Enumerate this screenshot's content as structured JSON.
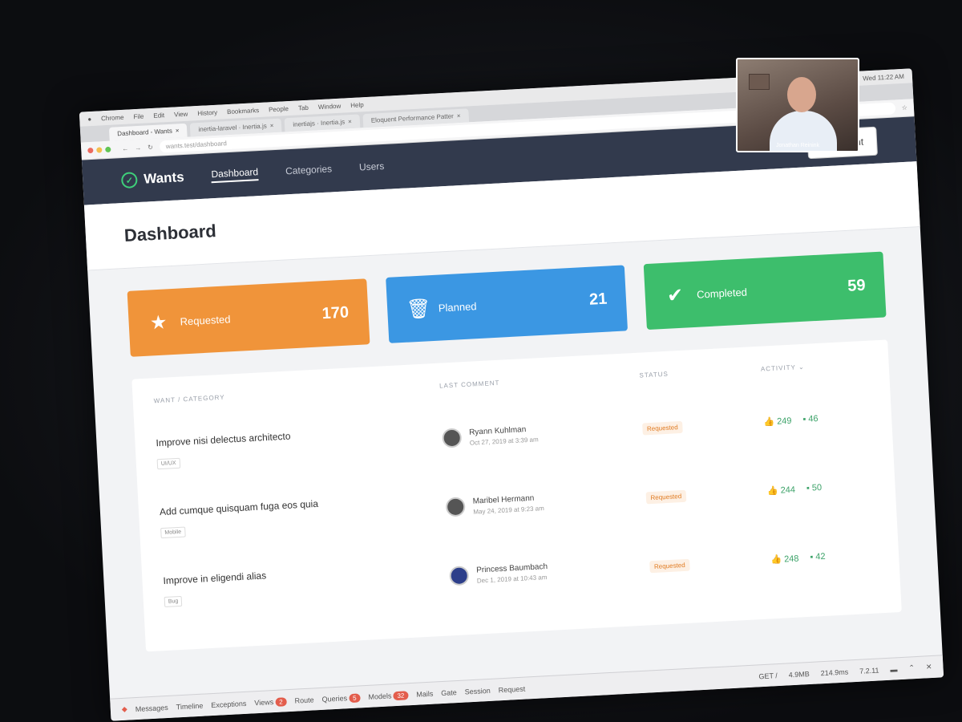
{
  "mac_menubar": {
    "items": [
      "Chrome",
      "File",
      "Edit",
      "View",
      "History",
      "Bookmarks",
      "People",
      "Tab",
      "Window",
      "Help"
    ],
    "right": "Wed 11:22 AM"
  },
  "browser": {
    "tabs": [
      {
        "label": "Dashboard - Wants"
      },
      {
        "label": "inertia-laravel · Inertia.js"
      },
      {
        "label": "inertiajs · Inertia.js"
      },
      {
        "label": "Eloquent Performance Patter"
      }
    ],
    "url": "wants.test/dashboard"
  },
  "navbar": {
    "brand": "Wants",
    "brand_icon": "✓",
    "links": [
      "Dashboard",
      "Categories",
      "Users"
    ],
    "new_want": "New want"
  },
  "page": {
    "title": "Dashboard"
  },
  "cards": [
    {
      "label": "Requested",
      "count": "170",
      "color": "#f0943a",
      "icon": "★"
    },
    {
      "label": "Planned",
      "count": "21",
      "color": "#3b97e3",
      "icon": "🗑"
    },
    {
      "label": "Completed",
      "count": "59",
      "color": "#3dbe6c",
      "icon": "✔"
    }
  ],
  "table": {
    "headers": [
      "Want / Category",
      "Last Comment",
      "Status",
      "Activity ⌄"
    ],
    "rows": [
      {
        "title": "Improve nisi delectus architecto",
        "category": "UI/UX",
        "commenter": "Ryann Kuhlman",
        "date": "Oct 27, 2019 at 3:39 am",
        "status": "Requested",
        "votes": "249",
        "comments": "46"
      },
      {
        "title": "Add cumque quisquam fuga eos quia",
        "category": "Mobile",
        "commenter": "Maribel Hermann",
        "date": "May 24, 2019 at 9:23 am",
        "status": "Requested",
        "votes": "244",
        "comments": "50"
      },
      {
        "title": "Improve in eligendi alias",
        "category": "Bug",
        "commenter": "Princess Baumbach",
        "date": "Dec 1, 2019 at 10:43 am",
        "status": "Requested",
        "votes": "248",
        "comments": "42"
      }
    ]
  },
  "debugbar": {
    "tabs": [
      {
        "label": "Messages"
      },
      {
        "label": "Timeline"
      },
      {
        "label": "Exceptions"
      },
      {
        "label": "Views",
        "badge": "2"
      },
      {
        "label": "Route"
      },
      {
        "label": "Queries",
        "badge": "5"
      },
      {
        "label": "Models",
        "badge": "32"
      },
      {
        "label": "Mails"
      },
      {
        "label": "Gate"
      },
      {
        "label": "Session"
      },
      {
        "label": "Request"
      }
    ],
    "right": [
      "GET /",
      "4.9MB",
      "214.9ms",
      "7.2.11"
    ]
  },
  "webcam": {
    "caption": "Jonathan Reinink"
  }
}
